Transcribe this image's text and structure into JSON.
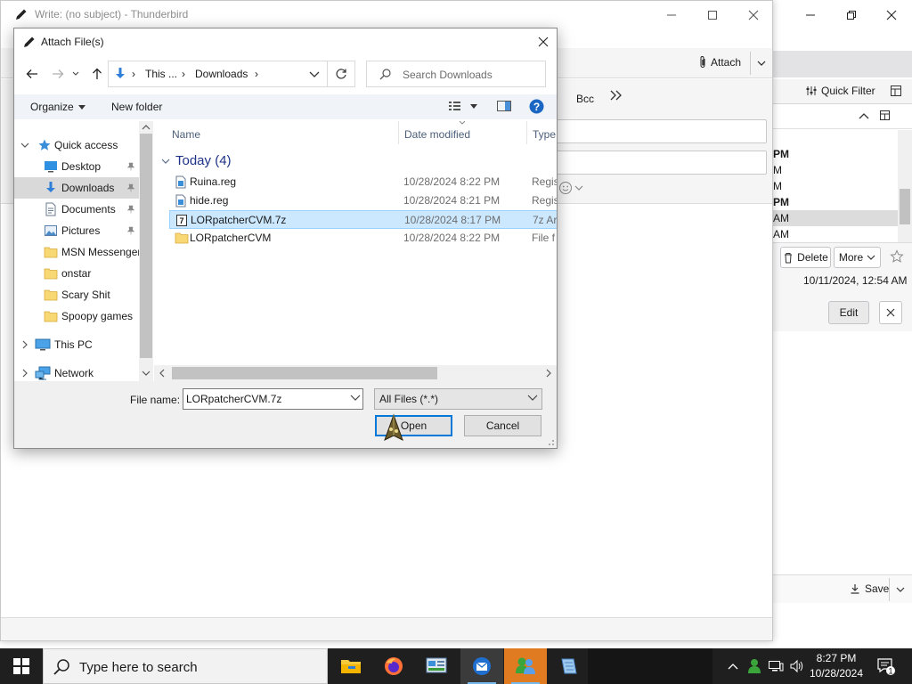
{
  "main_window": {
    "quick_filter_label": "Quick Filter",
    "thread_times": [
      "PM",
      "M",
      "M",
      "PM",
      "AM",
      "AM"
    ],
    "delete_label": "Delete",
    "more_label": "More",
    "message_date": "10/11/2024, 12:54 AM",
    "edit_label": "Edit",
    "save_label": "Save"
  },
  "compose": {
    "title": "Write: (no subject) - Thunderbird",
    "attach_label": "Attach",
    "bcc_label": "Bcc"
  },
  "dialog": {
    "title": "Attach File(s)",
    "breadcrumb": [
      "This ...",
      "Downloads"
    ],
    "search_placeholder": "Search Downloads",
    "organize_label": "Organize",
    "new_folder_label": "New folder",
    "nav_items": [
      {
        "label": "Quick access",
        "icon": "star-icon",
        "level": 0,
        "expanded": true,
        "pinned": false,
        "selected": false
      },
      {
        "label": "Desktop",
        "icon": "desktop-icon",
        "level": 1,
        "pinned": true,
        "selected": false
      },
      {
        "label": "Downloads",
        "icon": "download-icon",
        "level": 1,
        "pinned": true,
        "selected": true
      },
      {
        "label": "Documents",
        "icon": "documents-icon",
        "level": 1,
        "pinned": true,
        "selected": false
      },
      {
        "label": "Pictures",
        "icon": "pictures-icon",
        "level": 1,
        "pinned": true,
        "selected": false
      },
      {
        "label": "MSN Messenger",
        "icon": "folder-icon",
        "level": 1,
        "pinned": false,
        "selected": false
      },
      {
        "label": "onstar",
        "icon": "folder-icon",
        "level": 1,
        "pinned": false,
        "selected": false
      },
      {
        "label": "Scary Shit",
        "icon": "folder-icon",
        "level": 1,
        "pinned": false,
        "selected": false
      },
      {
        "label": "Spoopy games",
        "icon": "folder-icon",
        "level": 1,
        "pinned": false,
        "selected": false
      },
      {
        "label": "This PC",
        "icon": "this-pc-icon",
        "level": 0,
        "expanded": false,
        "pinned": false,
        "selected": false
      },
      {
        "label": "Network",
        "icon": "network-icon",
        "level": 0,
        "expanded": false,
        "pinned": false,
        "selected": false
      }
    ],
    "columns": {
      "name": "Name",
      "date": "Date modified",
      "type": "Type"
    },
    "group_label": "Today (4)",
    "files": [
      {
        "name": "Ruina.reg",
        "date": "10/28/2024 8:22 PM",
        "type": "Regis",
        "icon": "reg-file-icon",
        "selected": false
      },
      {
        "name": "hide.reg",
        "date": "10/28/2024 8:21 PM",
        "type": "Regis",
        "icon": "reg-file-icon",
        "selected": false
      },
      {
        "name": "LORpatcherCVM.7z",
        "date": "10/28/2024 8:17 PM",
        "type": "7z Ar",
        "icon": "archive-file-icon",
        "selected": true
      },
      {
        "name": "LORpatcherCVM",
        "date": "10/28/2024 8:22 PM",
        "type": "File f",
        "icon": "folder-icon",
        "selected": false
      }
    ],
    "file_name_label": "File name:",
    "file_name_value": "LORpatcherCVM.7z",
    "file_type_value": "All Files (*.*)",
    "open_label": "Open",
    "cancel_label": "Cancel"
  },
  "taskbar": {
    "search_placeholder": "Type here to search",
    "time": "8:27 PM",
    "date": "10/28/2024",
    "notification_count": "1"
  },
  "colors": {
    "accent": "#0078d7",
    "selection": "#cce8ff",
    "folder": "#f8d775",
    "taskbar": "#1f1f1f"
  }
}
